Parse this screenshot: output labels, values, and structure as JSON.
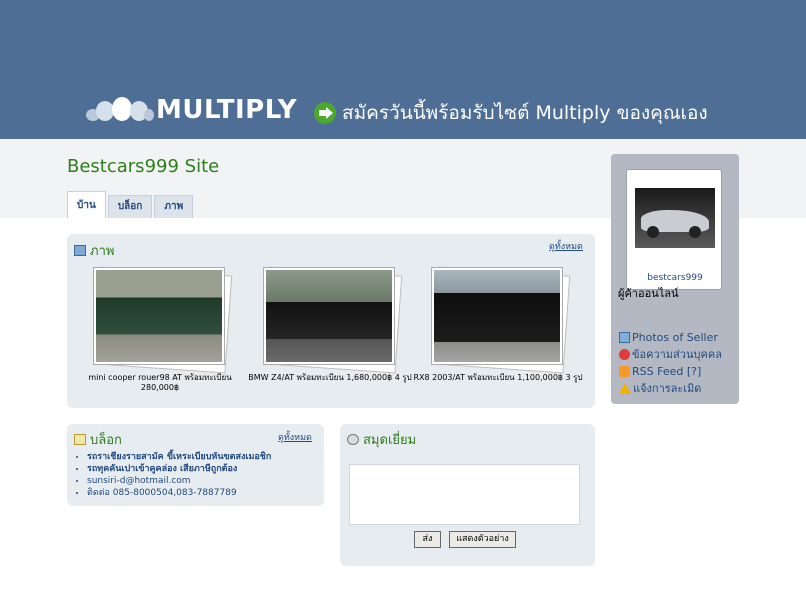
{
  "header": {
    "logo_text": "MULTIPLY",
    "signup_text": "สมัครวันนี้พร้อมรับไซต์ Multiply ของคุณเอง"
  },
  "site": {
    "title": "Bestcars999 Site"
  },
  "tabs": [
    {
      "label": "บ้าน",
      "active": true
    },
    {
      "label": "บล็อก",
      "active": false
    },
    {
      "label": "ภาพ",
      "active": false
    }
  ],
  "photos": {
    "title": "ภาพ",
    "see_all": "ดูทั้งหมด",
    "items": [
      {
        "caption": "mini cooper rouer98 AT พร้อมทะเบียน 280,000฿"
      },
      {
        "caption": "BMW Z4/AT พร้อมทะเบียน 1,680,000฿ 4 รูป"
      },
      {
        "caption": "RX8 2003/AT พร้อมทะเบียน 1,100,000฿ 3 รูป"
      }
    ]
  },
  "blog": {
    "title": "บล็อก",
    "see_all": "ดูทั้งหมด",
    "items": [
      "รถราเชียงรายสามัค ขี้เหระเบียบหันขตสงเมอชิก",
      "รถทุคคันเปาเข้าคูคล่อง เสียภาษีถูกต้อง",
      "sunsiri-d@hotmail.com",
      "ติดต่อ 085-8000504,083-7887789"
    ]
  },
  "guestbook": {
    "title": "สมุดเยี่ยม",
    "send_label": "ส่ง",
    "preview_label": "แสดงตัวอย่าง"
  },
  "sidebar": {
    "username": "bestcars999",
    "status": "ผู้ค้าออนไลน์",
    "links": [
      {
        "label": "Photos of Seller",
        "icon": "photo-icon"
      },
      {
        "label": "ข้อความส่วนบุคคล",
        "icon": "message-icon"
      },
      {
        "label": "RSS Feed [?]",
        "icon": "rss-icon"
      },
      {
        "label": "แจ้งการละเมิด",
        "icon": "warning-icon"
      }
    ]
  },
  "colors": {
    "header_bg": "#4e6e95",
    "title_green": "#2e7d1e",
    "link_blue": "#224a80",
    "panel_bg": "#e7ecf0",
    "sidebar_bg": "#b3b8c2"
  }
}
